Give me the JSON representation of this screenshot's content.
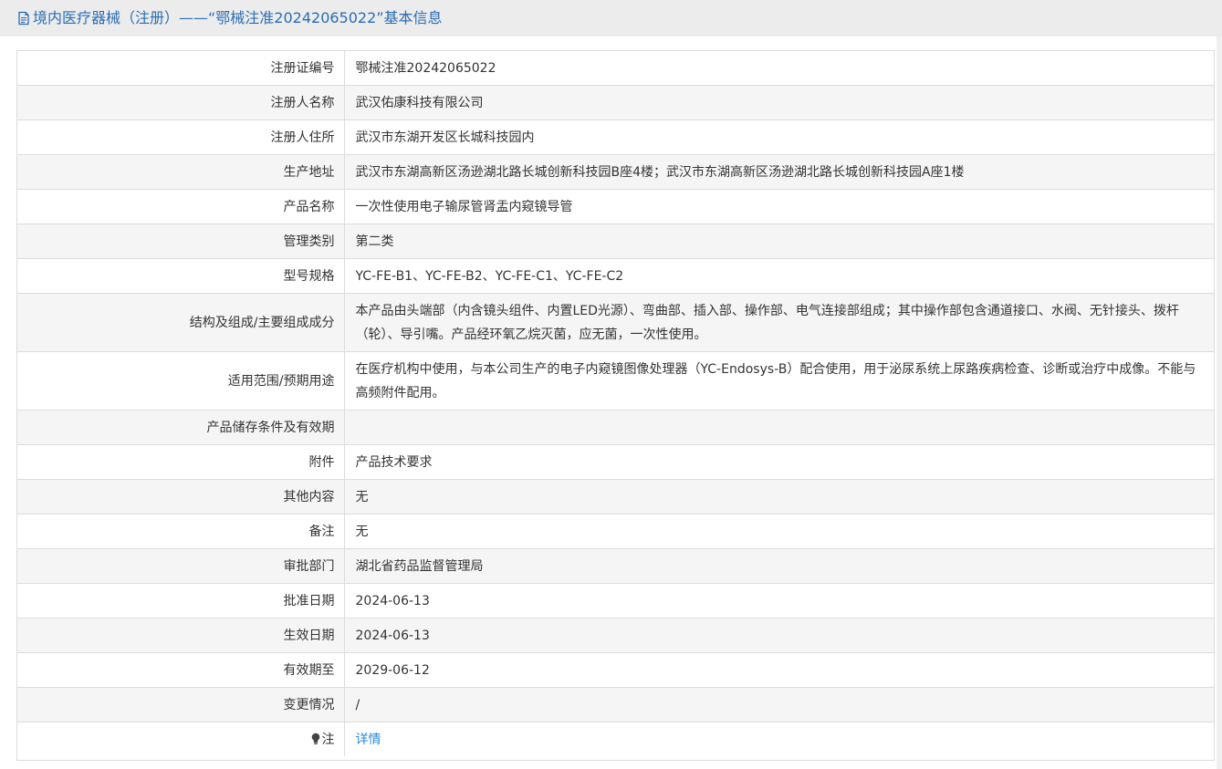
{
  "header": {
    "icon": "document-icon",
    "title": "境内医疗器械（注册）——“鄂械注准20242065022”基本信息"
  },
  "rows": [
    {
      "label": "注册证编号",
      "value": "鄂械注准20242065022"
    },
    {
      "label": "注册人名称",
      "value": "武汉佑康科技有限公司"
    },
    {
      "label": "注册人住所",
      "value": "武汉市东湖开发区长城科技园内"
    },
    {
      "label": "生产地址",
      "value": "武汉市东湖高新区汤逊湖北路长城创新科技园B座4楼；武汉市东湖高新区汤逊湖北路长城创新科技园A座1楼"
    },
    {
      "label": "产品名称",
      "value": "一次性使用电子输尿管肾盂内窥镜导管"
    },
    {
      "label": "管理类别",
      "value": "第二类"
    },
    {
      "label": "型号规格",
      "value": "YC-FE-B1、YC-FE-B2、YC-FE-C1、YC-FE-C2"
    },
    {
      "label": "结构及组成/主要组成成分",
      "value": "本产品由头端部（内含镜头组件、内置LED光源）、弯曲部、插入部、操作部、电气连接部组成；其中操作部包含通道接口、水阀、无针接头、拨杆（轮）、导引嘴。产品经环氧乙烷灭菌，应无菌，一次性使用。"
    },
    {
      "label": "适用范围/预期用途",
      "value": "在医疗机构中使用，与本公司生产的电子内窥镜图像处理器（YC-Endosys-B）配合使用，用于泌尿系统上尿路疾病检查、诊断或治疗中成像。不能与高频附件配用。"
    },
    {
      "label": "产品储存条件及有效期",
      "value": ""
    },
    {
      "label": "附件",
      "value": "产品技术要求"
    },
    {
      "label": "其他内容",
      "value": "无"
    },
    {
      "label": "备注",
      "value": "无"
    },
    {
      "label": "审批部门",
      "value": "湖北省药品监督管理局"
    },
    {
      "label": "批准日期",
      "value": "2024-06-13"
    },
    {
      "label": "生效日期",
      "value": "2024-06-13"
    },
    {
      "label": "有效期至",
      "value": "2029-06-12"
    },
    {
      "label": "变更情况",
      "value": "/"
    }
  ],
  "note_row": {
    "icon": "lightbulb-icon",
    "label": "注",
    "link_text": "详情"
  }
}
